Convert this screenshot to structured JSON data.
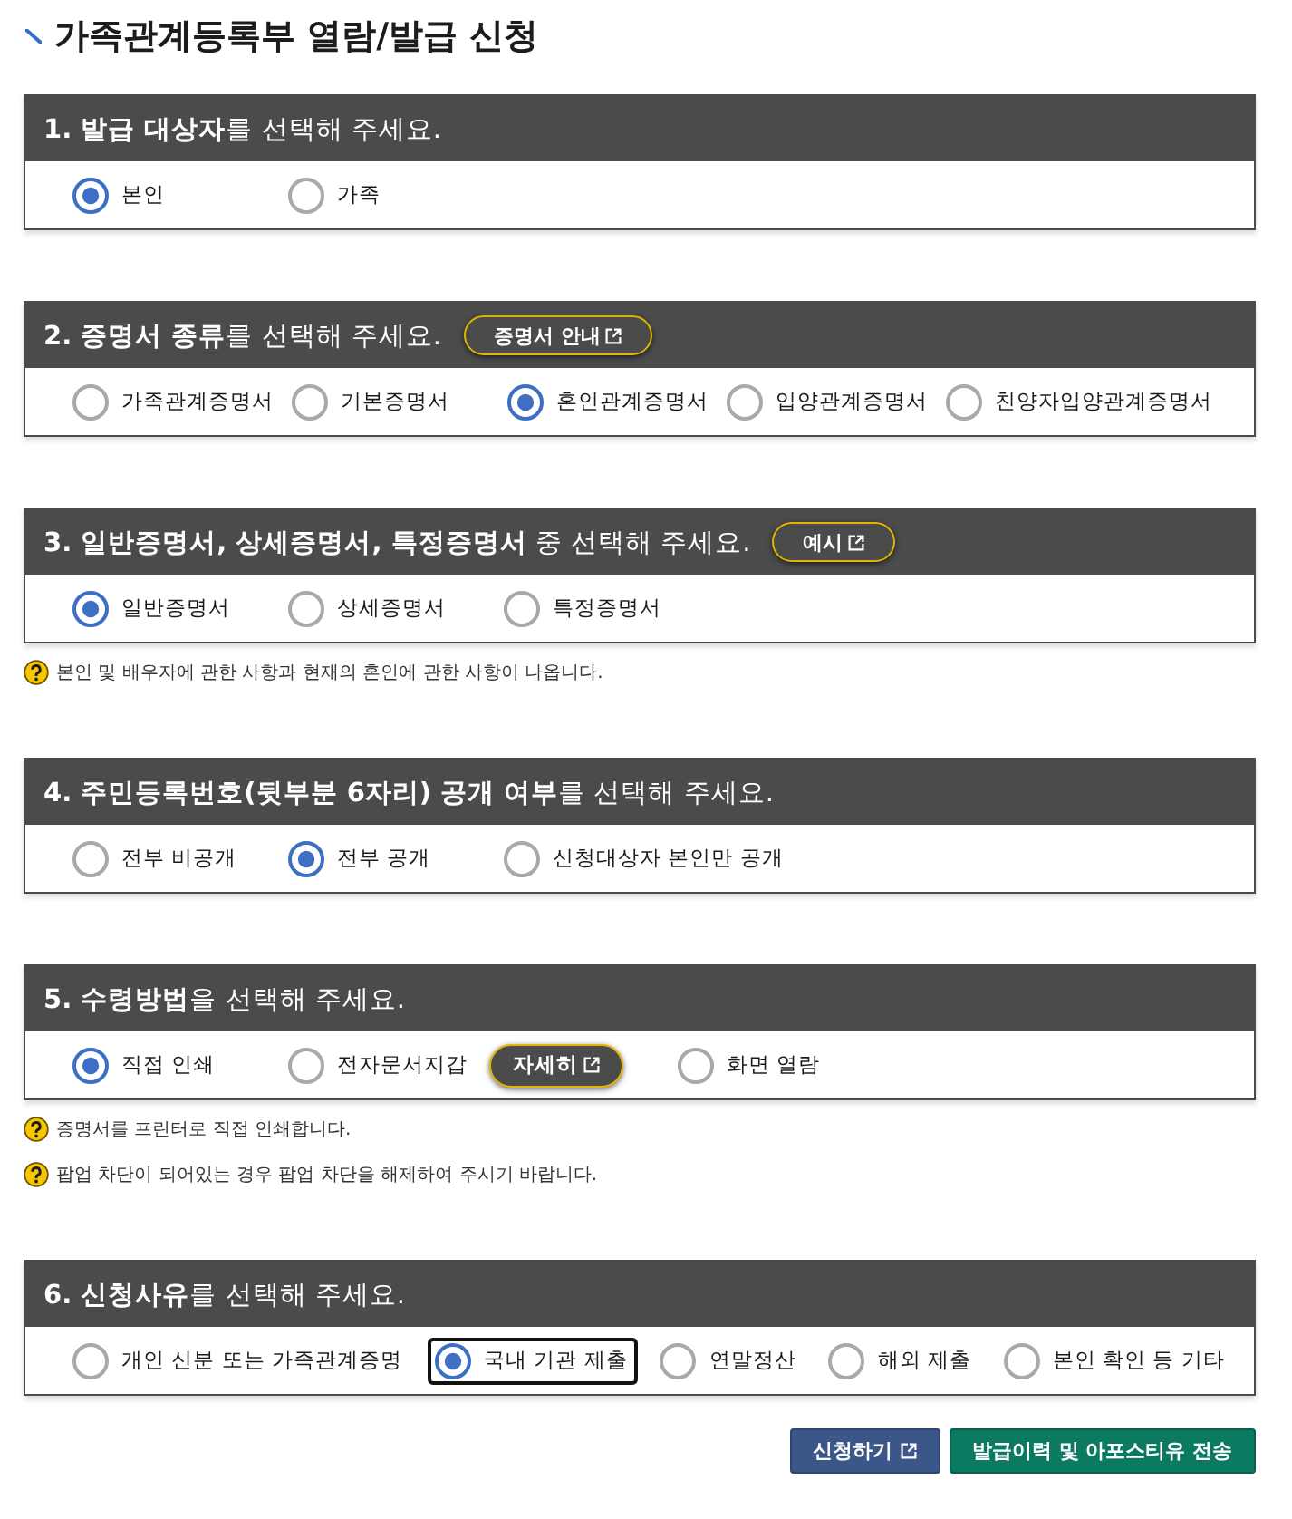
{
  "page_title": "가족관계등록부 열람/발급 신청",
  "sections": [
    {
      "heading": "**1. 발급 대상자**를 선택해 주세요.",
      "options": [
        {
          "label": "본인",
          "selected": true
        },
        {
          "label": "가족",
          "selected": false
        }
      ]
    },
    {
      "heading": "**2. 증명서 종류**를 선택해 주세요.",
      "header_button": {
        "label": "증명서 안내"
      },
      "options": [
        {
          "label": "가족관계증명서",
          "selected": false
        },
        {
          "label": "기본증명서",
          "selected": false
        },
        {
          "label": "혼인관계증명서",
          "selected": true
        },
        {
          "label": "입양관계증명서",
          "selected": false
        },
        {
          "label": "친양자입양관계증명서",
          "selected": false
        }
      ]
    },
    {
      "heading": "**3. 일반증명서, 상세증명서, 특정증명서** 중 선택해 주세요.",
      "header_button": {
        "label": "예시"
      },
      "options": [
        {
          "label": "일반증명서",
          "selected": true
        },
        {
          "label": "상세증명서",
          "selected": false
        },
        {
          "label": "특정증명서",
          "selected": false
        }
      ],
      "notes": [
        "본인 및 배우자에 관한 사항과 현재의 혼인에 관한 사항이 나옵니다."
      ]
    },
    {
      "heading": "**4. 주민등록번호(뒷부분 6자리) 공개 여부**를 선택해 주세요.",
      "options": [
        {
          "label": "전부 비공개",
          "selected": false
        },
        {
          "label": "전부 공개",
          "selected": true
        },
        {
          "label": "신청대상자 본인만 공개",
          "selected": false
        }
      ]
    },
    {
      "heading": "**5. 수령방법**을 선택해 주세요.",
      "options": [
        {
          "label": "직접 인쇄",
          "selected": true
        },
        {
          "label": "전자문서지갑",
          "selected": false,
          "button": {
            "label": "자세히"
          }
        },
        {
          "label": "화면 열람",
          "selected": false
        }
      ],
      "notes": [
        "증명서를 프린터로 직접 인쇄합니다.",
        "팝업 차단이 되어있는 경우 팝업 차단을 해제하여 주시기 바랍니다."
      ]
    },
    {
      "heading": "**6. 신청사유**를 선택해 주세요.",
      "options": [
        {
          "label": "개인 신분 또는 가족관계증명",
          "selected": false,
          "focused": false
        },
        {
          "label": "국내 기관 제출",
          "selected": true,
          "focused": true
        },
        {
          "label": "연말정산",
          "selected": false,
          "focused": false
        },
        {
          "label": "해외 제출",
          "selected": false,
          "focused": false
        },
        {
          "label": "본인 확인 등 기타",
          "selected": false,
          "focused": false
        }
      ]
    }
  ],
  "actions": [
    {
      "label": "신청하기",
      "kind": "primary",
      "external": true
    },
    {
      "label": "발급이력 및 아포스티유 전송",
      "kind": "secondary",
      "external": false
    }
  ]
}
